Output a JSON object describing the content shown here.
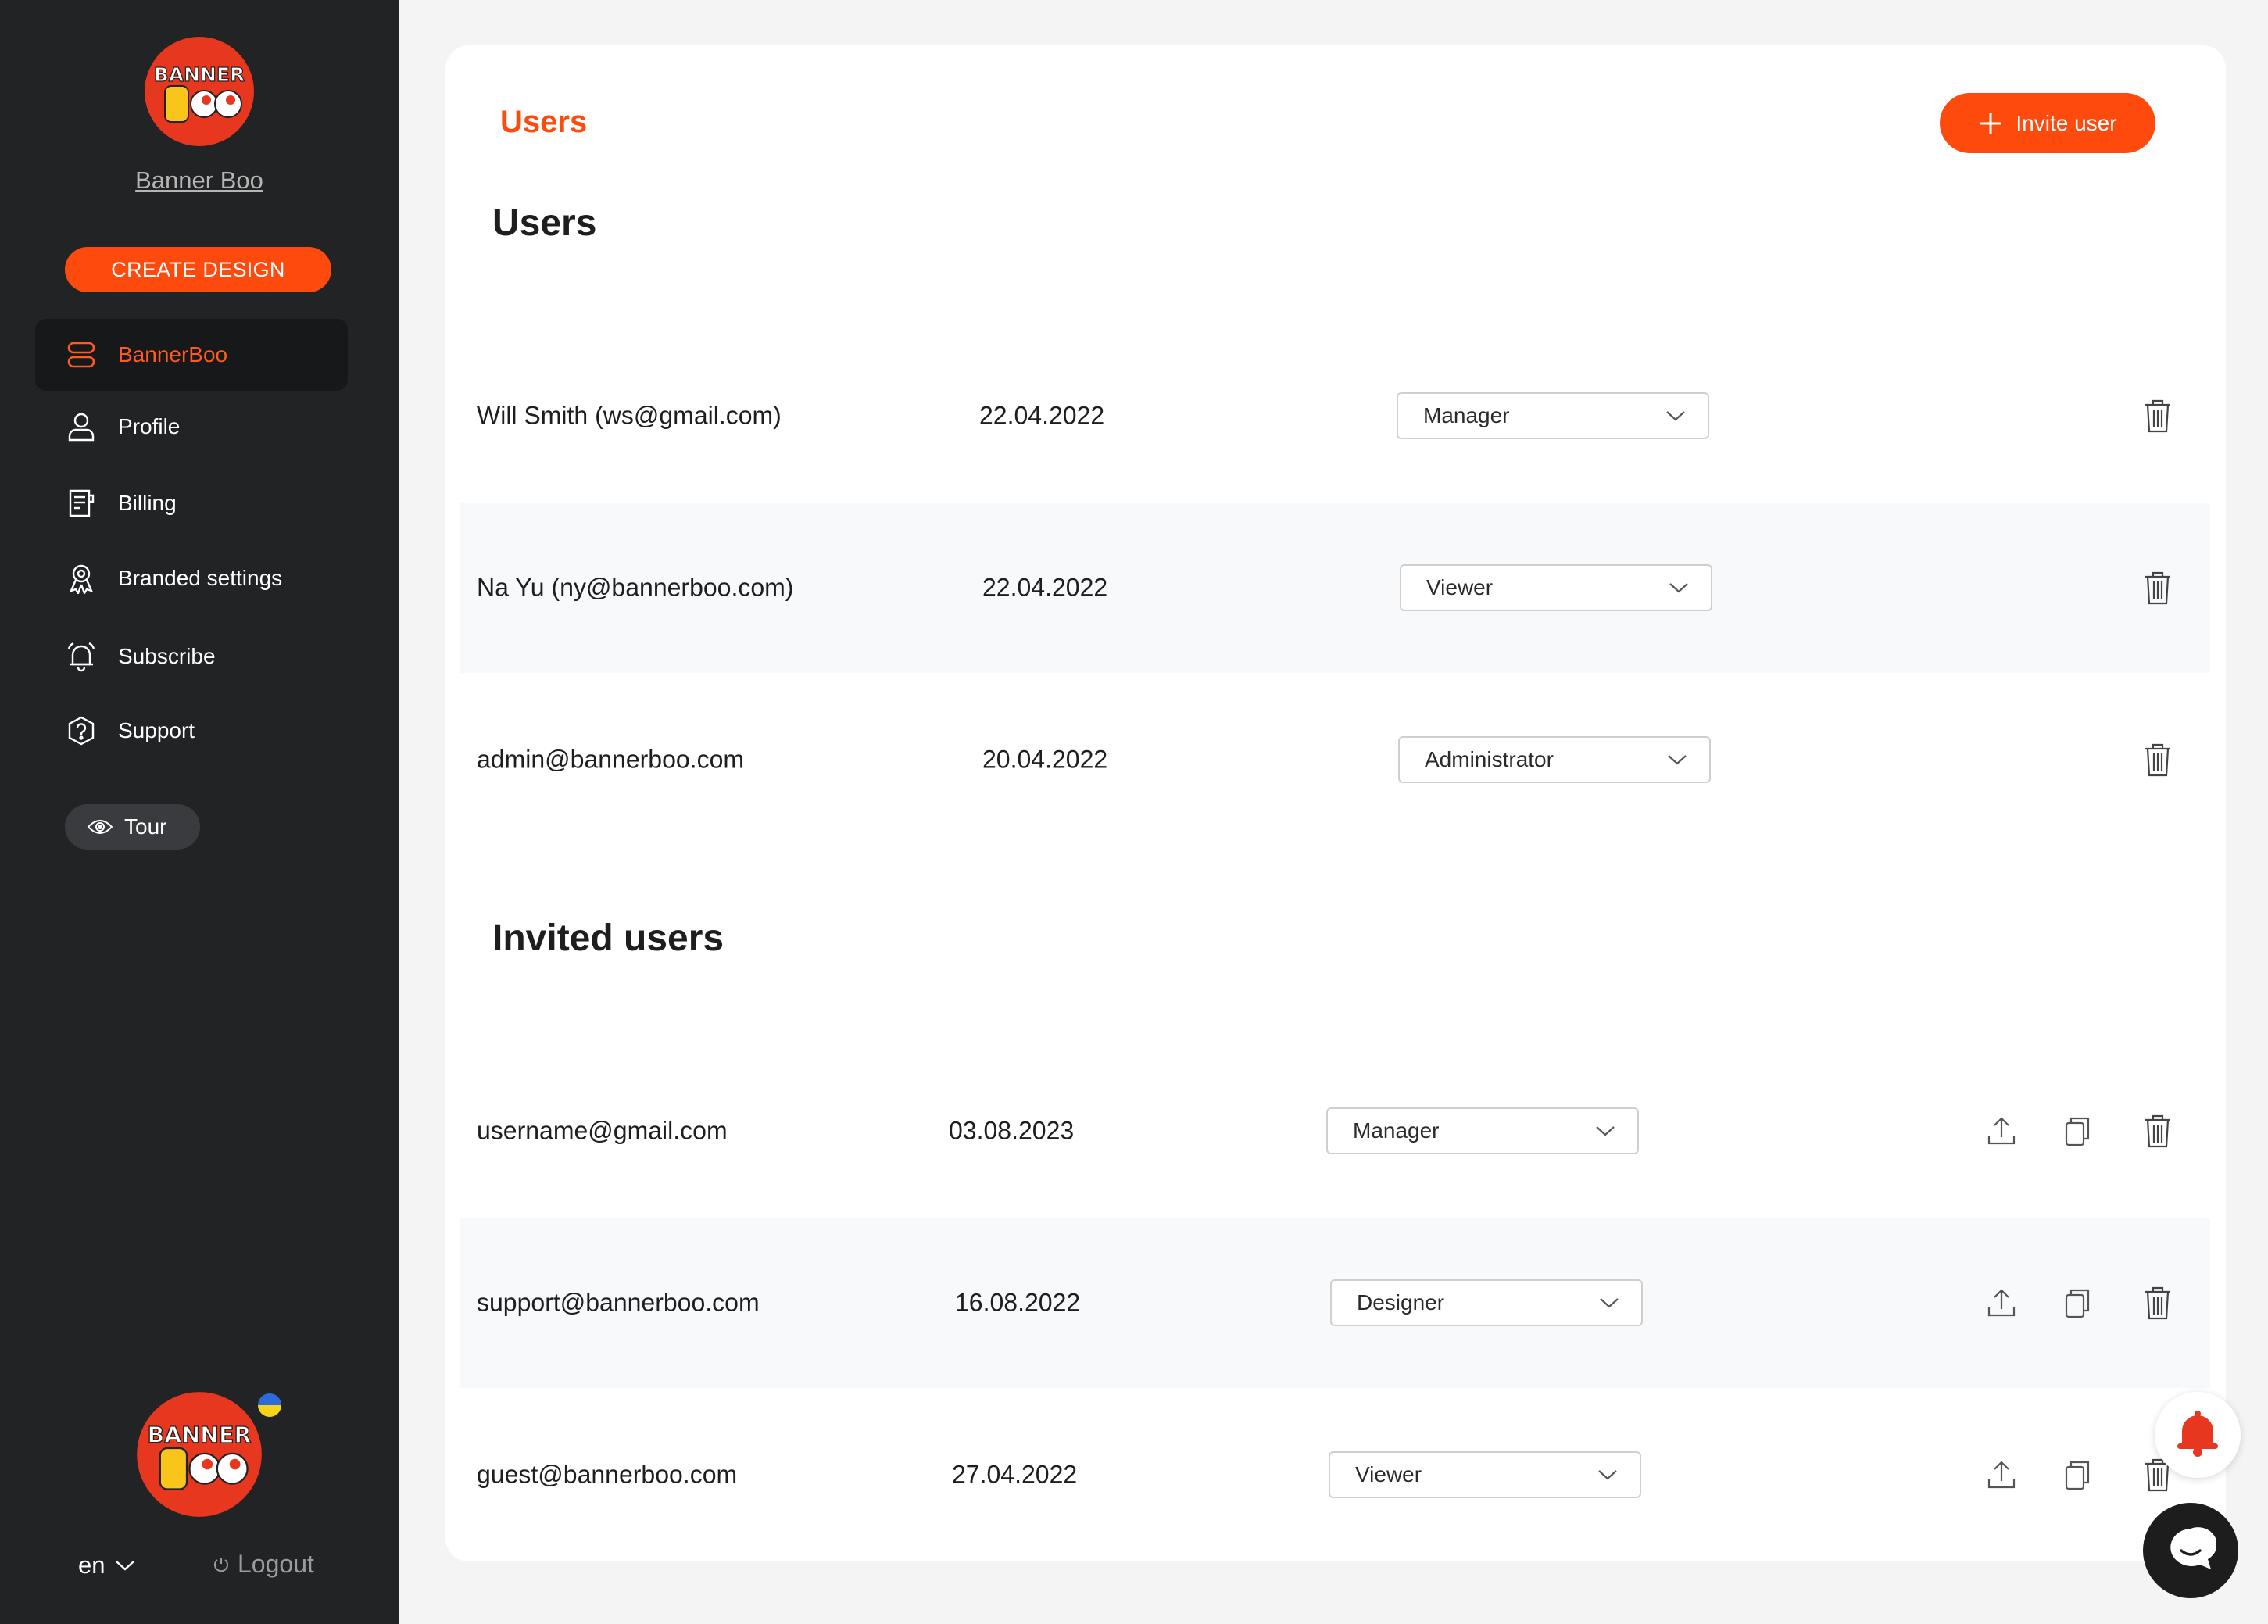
{
  "sidebar": {
    "logo_alt": "BannerBoo logo",
    "account_name": "Banner Boo",
    "create_label": "CREATE DESIGN",
    "items": [
      {
        "label": "BannerBoo",
        "icon": "layers-icon",
        "active": true
      },
      {
        "label": "Profile",
        "icon": "user-icon"
      },
      {
        "label": "Billing",
        "icon": "receipt-icon"
      },
      {
        "label": "Branded settings",
        "icon": "award-icon"
      },
      {
        "label": "Subscribe",
        "icon": "bell-icon"
      },
      {
        "label": "Support",
        "icon": "help-icon"
      }
    ],
    "tour_label": "Tour",
    "language": "en",
    "logout_label": "Logout"
  },
  "page": {
    "breadcrumb": "Users",
    "invite_label": "Invite user",
    "users_title": "Users",
    "invited_title": "Invited users"
  },
  "users": [
    {
      "email": "Will Smith (ws@gmail.com)",
      "date": "22.04.2022",
      "role": "Manager"
    },
    {
      "email": "Na Yu (ny@bannerboo.com)",
      "date": "22.04.2022",
      "role": "Viewer"
    },
    {
      "email": "admin@bannerboo.com",
      "date": "20.04.2022",
      "role": "Administrator"
    }
  ],
  "invited": [
    {
      "email": "username@gmail.com",
      "date": "03.08.2023",
      "role": "Manager"
    },
    {
      "email": "support@bannerboo.com",
      "date": "16.08.2022",
      "role": "Designer"
    },
    {
      "email": "guest@bannerboo.com",
      "date": "27.04.2022",
      "role": "Viewer"
    }
  ],
  "colors": {
    "accent": "#ff4a0d",
    "sidebar_bg": "#222325",
    "row_alt": "#f8f9fb"
  }
}
